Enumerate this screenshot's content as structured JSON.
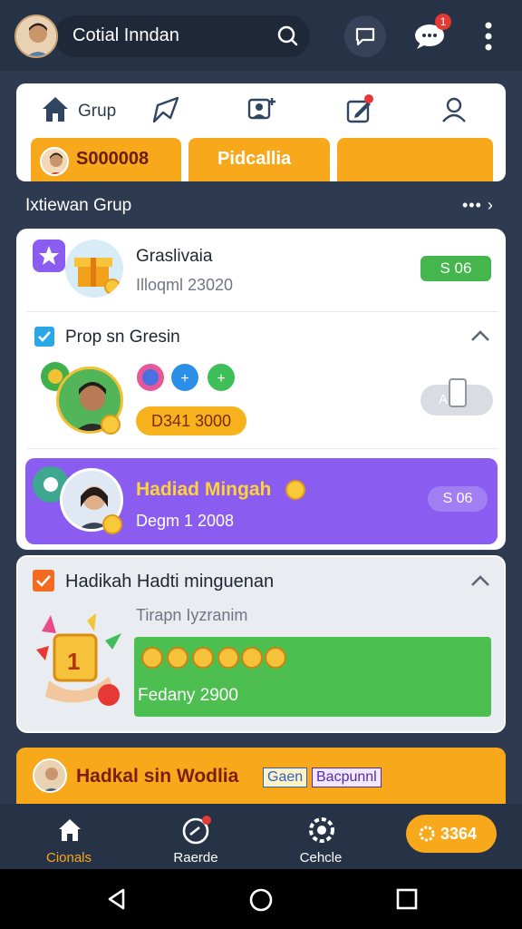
{
  "header": {
    "title": "Cotial Inndan",
    "notification_badge": "1",
    "icons": [
      "avatar",
      "search-icon",
      "chat-icon",
      "chat-bubble-icon",
      "more-vertical-icon"
    ]
  },
  "group_card": {
    "home_label": "Grup",
    "tabs": [
      {
        "label": "S000008"
      },
      {
        "label": "Pidcallia"
      },
      {
        "label": ""
      }
    ]
  },
  "section": {
    "title": "Ixtiewan Grup",
    "more": "••• ›"
  },
  "list": {
    "item1": {
      "title": "Graslivaia",
      "subtitle": "Illoqml 23020",
      "badge": "S 06"
    },
    "item2": {
      "title": "Prop sn Gresin",
      "amount": "D341 3000",
      "pill": "A 2"
    },
    "item3": {
      "title": "Hadiad Mingah",
      "subtitle": "Degm 1 2008",
      "badge": "S 06"
    }
  },
  "mission": {
    "title": "Hadikah Hadti minguenan",
    "subtitle": "Tirapn Iyzranim",
    "reward_label": "Fedany 2900",
    "trophy_number": "1"
  },
  "banner": {
    "text": "Hadkal sin Wodlia",
    "tag1": "Gaen",
    "tag2": "Bacpunnl"
  },
  "bottom_nav": {
    "items": [
      {
        "label": "Cionals"
      },
      {
        "label": "Raerde"
      },
      {
        "label": "Cehcle"
      }
    ],
    "coins": "3364"
  },
  "colors": {
    "accent_yellow": "#f7a81b",
    "green": "#45b64d",
    "purple": "#8a5cf0",
    "navy": "#2d3a4f"
  }
}
